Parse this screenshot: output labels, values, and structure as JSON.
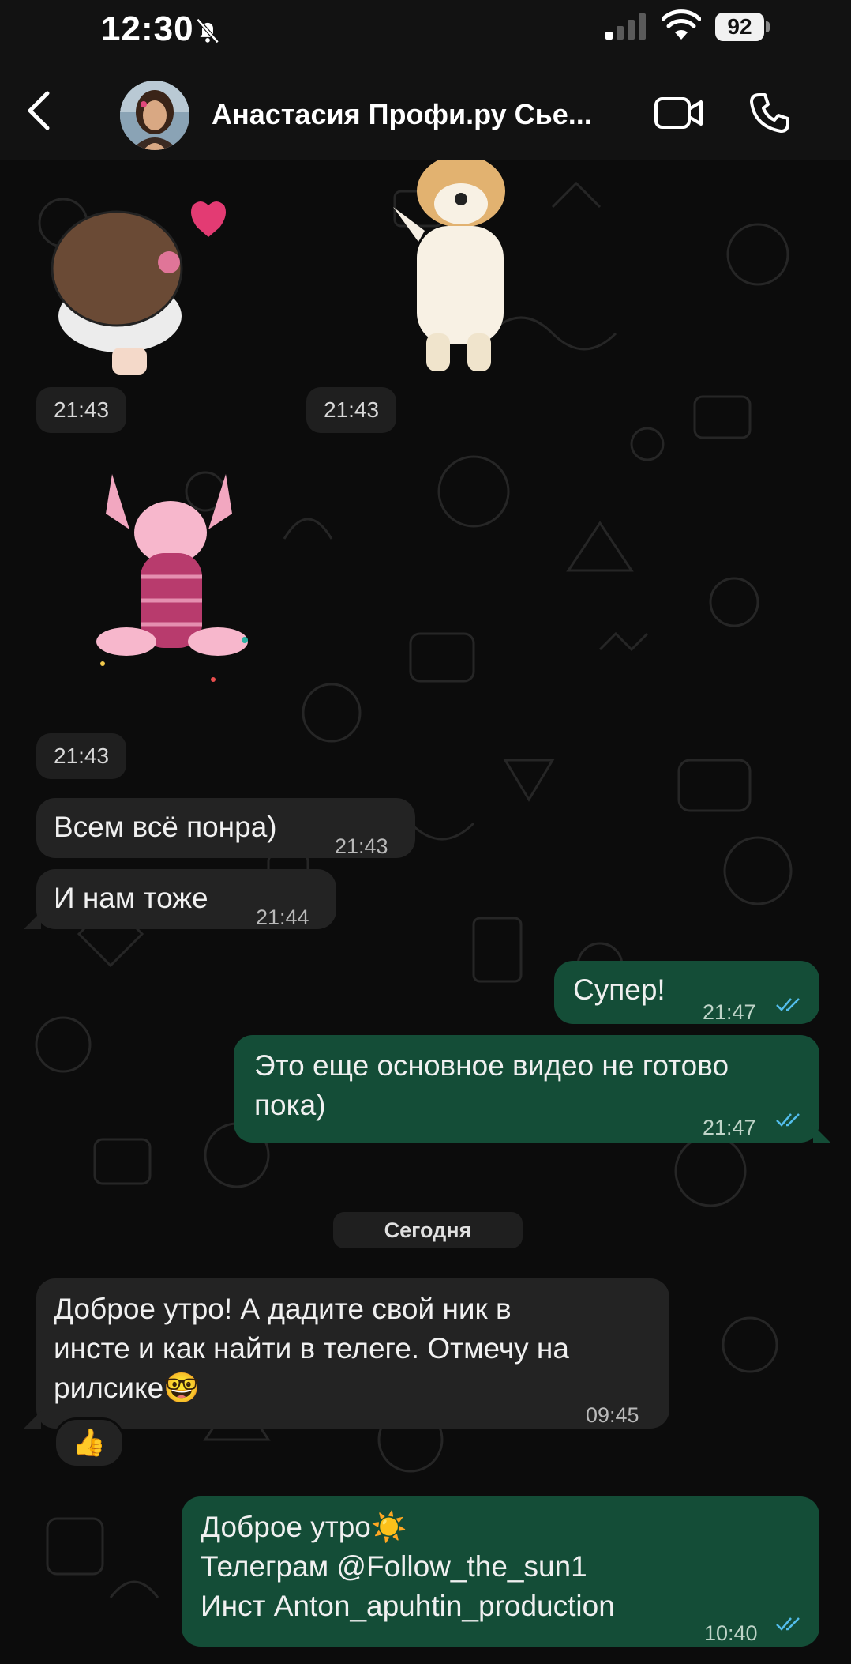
{
  "status_bar": {
    "time": "12:30",
    "battery": "92"
  },
  "header": {
    "title": "Анастасия Профи.ру Сье..."
  },
  "messages": {
    "sticker_time_1": "21:43",
    "sticker_time_2": "21:43",
    "sticker_time_3": "21:43",
    "in_1_text": "Всем всё понра)",
    "in_1_time": "21:43",
    "in_2_text": "И нам тоже",
    "in_2_time": "21:44",
    "out_1_text": "Супер!",
    "out_1_time": "21:47",
    "out_2_line1": "Это еще основное видео не готово",
    "out_2_line2": "пока)",
    "out_2_time": "21:47",
    "date_divider": "Сегодня",
    "in_3_line1": "Доброе утро! А дадите свой ник в",
    "in_3_line2": "инсте и как найти в телеге. Отмечу на",
    "in_3_line3": "рилсике🤓",
    "in_3_time": "09:45",
    "in_3_reaction": "👍",
    "out_3_line1": "Доброе утро☀️",
    "out_3_line2": "Телеграм @Follow_the_sun1",
    "out_3_line3": "Инст Anton_apuhtin_production",
    "out_3_time": "10:40"
  },
  "colors": {
    "incoming_bubble": "#232323",
    "outgoing_bubble": "#144d37",
    "read_ticks": "#53bdeb"
  }
}
